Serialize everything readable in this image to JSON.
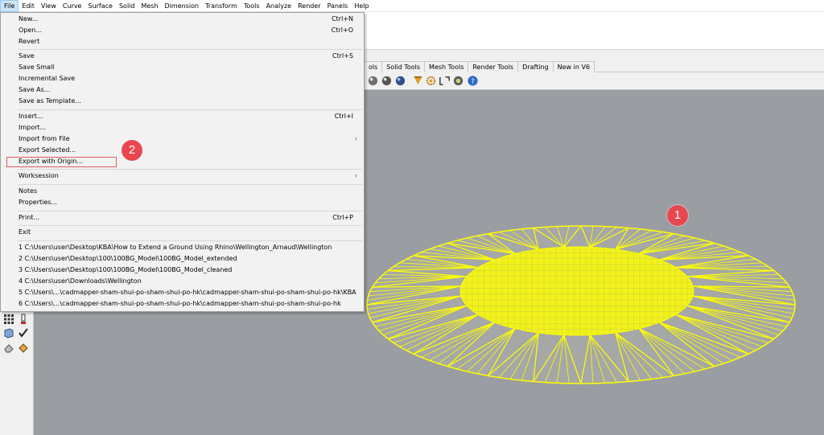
{
  "menubar": {
    "items": [
      "File",
      "Edit",
      "View",
      "Curve",
      "Surface",
      "Solid",
      "Mesh",
      "Dimension",
      "Transform",
      "Tools",
      "Analyze",
      "Render",
      "Panels",
      "Help"
    ]
  },
  "toolbar_tabs": [
    "ols",
    "Solid Tools",
    "Mesh Tools",
    "Render Tools",
    "Drafting",
    "New in V6"
  ],
  "file_menu": {
    "new": {
      "label": "New...",
      "shortcut": "Ctrl+N"
    },
    "open": {
      "label": "Open...",
      "shortcut": "Ctrl+O"
    },
    "revert": {
      "label": "Revert"
    },
    "save": {
      "label": "Save",
      "shortcut": "Ctrl+S"
    },
    "save_small": {
      "label": "Save Small"
    },
    "incremental_save": {
      "label": "Incremental Save"
    },
    "save_as": {
      "label": "Save As..."
    },
    "save_as_template": {
      "label": "Save as Template..."
    },
    "insert": {
      "label": "Insert...",
      "shortcut": "Ctrl+I"
    },
    "import": {
      "label": "Import..."
    },
    "import_from_file": {
      "label": "Import from File",
      "submenu_arrow": "›"
    },
    "export_selected": {
      "label": "Export Selected..."
    },
    "export_with_origin": {
      "label": "Export with Origin..."
    },
    "worksession": {
      "label": "Worksession",
      "submenu_arrow": "›"
    },
    "notes": {
      "label": "Notes"
    },
    "properties": {
      "label": "Properties..."
    },
    "print": {
      "label": "Print...",
      "shortcut": "Ctrl+P"
    },
    "exit": {
      "label": "Exit"
    },
    "recent": [
      "1 C:\\Users\\user\\Desktop\\KBA\\How to Extend a Ground  Using Rhino\\Wellington_Arnaud\\Wellington",
      "2 C:\\Users\\user\\Desktop\\100\\100BG_Model\\100BG_Model_extended",
      "3 C:\\Users\\user\\Desktop\\100\\100BG_Model\\100BG_Model_cleaned",
      "4 C:\\Users\\user\\Downloads\\Wellington",
      "5 C:\\Users\\...\\cadmapper-sham-shui-po-sham-shui-po-hk\\cadmapper-sham-shui-po-sham-shui-po-hk\\KBA",
      "6 C:\\Users\\...\\cadmapper-sham-shui-po-sham-shui-po-hk\\cadmapper-sham-shui-po-sham-shui-po-hk"
    ]
  },
  "annotations": {
    "badge1": "1",
    "badge2": "2"
  },
  "colors": {
    "viewport": "#9a9ea2",
    "mesh": "#ffff00",
    "badge": "#e8474f",
    "highlight": "#e05a64"
  }
}
